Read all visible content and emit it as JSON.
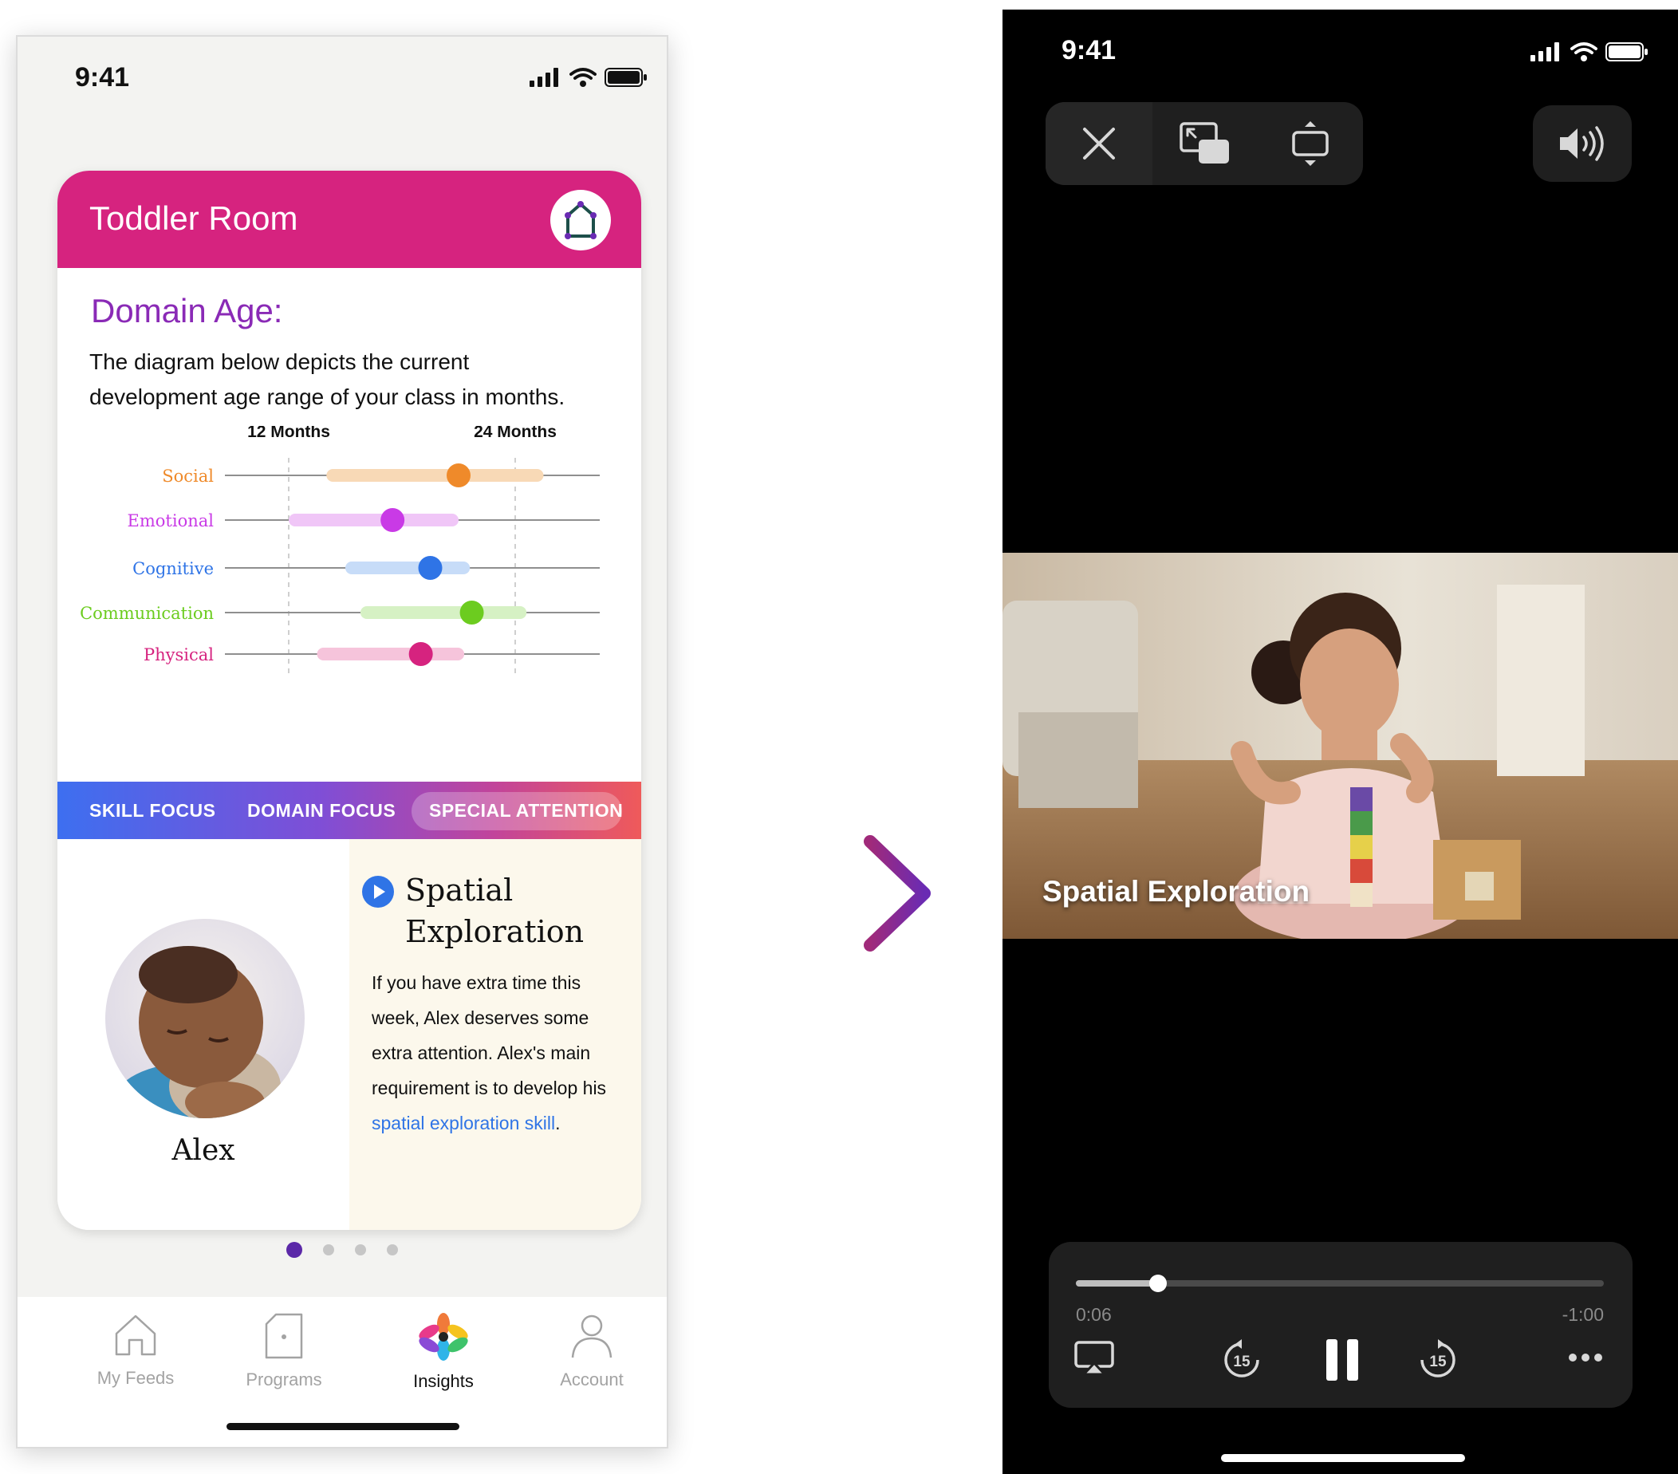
{
  "left_phone": {
    "status_time": "9:41",
    "card": {
      "title": "Toddler Room",
      "icon": "house-outline-icon",
      "header_color": "#d6237f"
    },
    "domain": {
      "title": "Domain Age:",
      "description": "The diagram below depicts the current development age range of your class in months."
    },
    "tabs": [
      {
        "label": "SKILL FOCUS",
        "active": false
      },
      {
        "label": "DOMAIN FOCUS",
        "active": false
      },
      {
        "label": "SPECIAL ATTENTION",
        "active": true
      }
    ],
    "child": {
      "name": "Alex"
    },
    "activity": {
      "title": "Spatial Exploration",
      "text": "If you have extra time this week, Alex deserves some extra attention. Alex's main requirement is to develop his ",
      "link": "spatial exploration skill",
      "trailing": "."
    },
    "pagination": {
      "count": 4,
      "active": 0
    },
    "nav": [
      {
        "label": "My Feeds",
        "icon": "home-icon",
        "active": false
      },
      {
        "label": "Programs",
        "icon": "document-icon",
        "active": false
      },
      {
        "label": "Insights",
        "icon": "flower-icon",
        "active": true
      },
      {
        "label": "Account",
        "icon": "person-icon",
        "active": false
      }
    ]
  },
  "chart_data": {
    "type": "range-dot",
    "x_ticks": [
      "12 Months",
      "24 Months"
    ],
    "categories": [
      "Social",
      "Emotional",
      "Cognitive",
      "Communication",
      "Physical"
    ],
    "colors": [
      "#ef8a2a",
      "#c93ae6",
      "#2f74e6",
      "#6ccc1f",
      "#d6237f"
    ],
    "range_colors": [
      "#f8d9b6",
      "#f0c6f7",
      "#c7dcf8",
      "#d6f1c4",
      "#f6c4db"
    ],
    "ranges": [
      [
        14,
        25.5
      ],
      [
        12,
        21
      ],
      [
        15,
        21.6
      ],
      [
        15.8,
        24.6
      ],
      [
        13.5,
        21.3
      ]
    ],
    "values": [
      21,
      17.5,
      19.5,
      21.7,
      19
    ]
  },
  "right_phone": {
    "status_time": "9:41",
    "controls": {
      "close_icon": "close-icon",
      "pip_icon": "picture-in-picture-icon",
      "resize_icon": "resize-icon",
      "volume_icon": "speaker-volume-icon"
    },
    "video_title": "Spatial Exploration",
    "progress": 0.155,
    "time_elapsed": "0:06",
    "time_remaining": "-1:00",
    "playback_controls": {
      "airplay_icon": "airplay-icon",
      "rewind_icon": "rewind-15-icon",
      "pause_icon": "pause-icon",
      "forward_icon": "forward-15-icon",
      "more_icon": "more-dots-icon",
      "skip_seconds": "15"
    }
  }
}
